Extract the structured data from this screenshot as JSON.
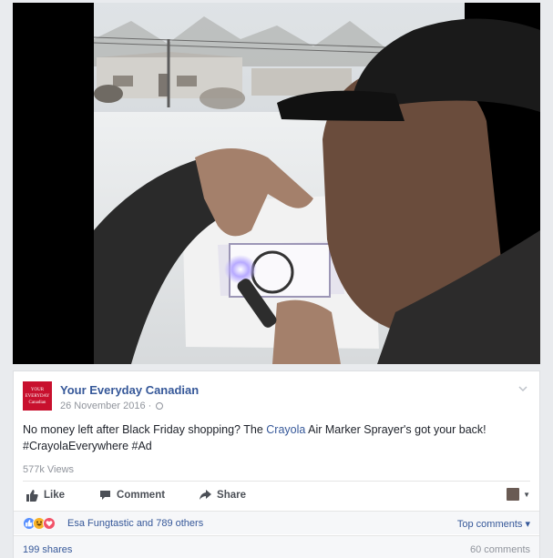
{
  "post": {
    "page_name": "Your Everyday Canadian",
    "page_logo_line1": "YOUR EVERYDAY",
    "page_logo_line2": "Canadian",
    "date": "26 November 2016",
    "date_separator": "·",
    "text_before_link": "No money left after Black Friday shopping? The ",
    "text_link": "Crayola",
    "text_after_link": " Air Marker Sprayer's got your back!",
    "hashtags": "#CrayolaEverywhere #Ad",
    "views": "577k Views"
  },
  "actions": {
    "like": "Like",
    "comment": "Comment",
    "share": "Share"
  },
  "reactions": {
    "summary": "Esa Fungtastic and 789 others",
    "top_comments": "Top comments",
    "top_comments_caret": "▾"
  },
  "stats": {
    "shares": "199 shares",
    "comments": "60 comments"
  },
  "icons": {
    "post_menu": "chevron-down-icon",
    "privacy": "globe-icon",
    "like": "thumbs-up-icon",
    "comment": "speech-bubble-icon",
    "share": "share-arrow-icon"
  },
  "colors": {
    "link": "#365899",
    "muted": "#90949c",
    "brand_red": "#c8102e",
    "reaction_like": "#5890ff",
    "reaction_haha": "#f7b125",
    "reaction_love": "#f25268"
  }
}
